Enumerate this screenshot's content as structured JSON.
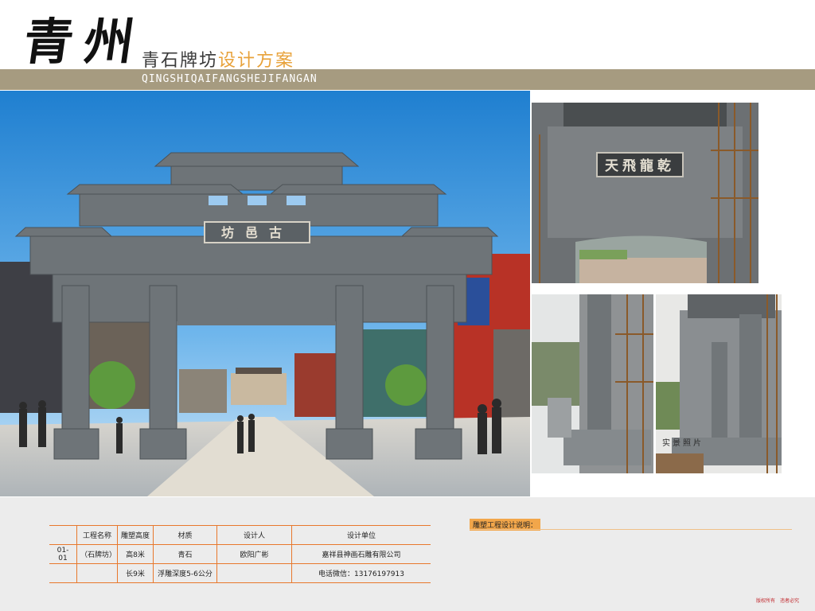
{
  "header": {
    "brush_title": "青州",
    "title_main": "青石牌坊",
    "title_accent": "设计方案",
    "subtitle_pinyin": "QINGSHIQAIFANGSHEJIFANGAN"
  },
  "main_photo": {
    "plaque": "坊邑古"
  },
  "side_photo_top": {
    "plaque": "天飛龍乾"
  },
  "side_photo_bottom_right": {
    "caption": "实景照片"
  },
  "spec_table": {
    "headers": [
      "",
      "工程名称",
      "雕塑高度",
      "材质",
      "设计人",
      "设计单位"
    ],
    "row1": [
      "01-01",
      "（石牌坊）",
      "高8米",
      "青石",
      "欧阳广彬",
      "嘉祥县神画石雕有限公司"
    ],
    "row2": [
      "",
      "",
      "长9米",
      "浮雕深度5-6公分",
      "",
      "电话微信：13176197913"
    ]
  },
  "design_note": {
    "label": "雕塑工程设计说明："
  },
  "footer": {
    "copyright": "版权所有",
    "warning": "违者必究"
  },
  "colors": {
    "band": "#a69b80",
    "accent": "#e8a23a",
    "table_line": "#e8782c",
    "footer_red": "#c0282d"
  }
}
